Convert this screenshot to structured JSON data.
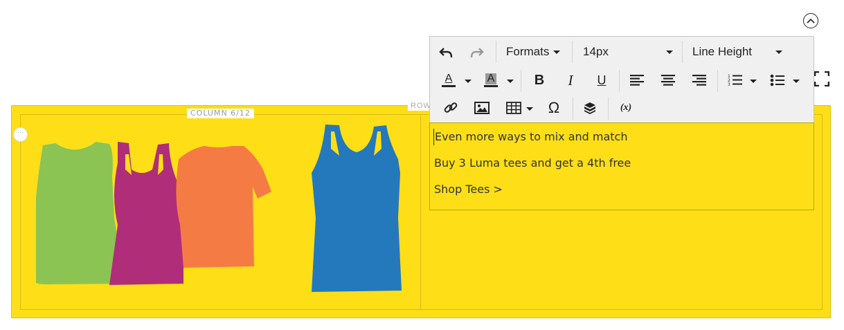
{
  "row": {
    "label": "ROW"
  },
  "column": {
    "label": "COLUMN 6/12",
    "options_label": "···"
  },
  "toolbar": {
    "formats_label": "Formats",
    "font_size_value": "14px",
    "line_height_label": "Line Height",
    "bold_label": "B",
    "italic_label": "I",
    "underline_label": "U",
    "font_color_label": "A",
    "highlight_label": "A",
    "variable_label": "(x)",
    "special_char_label": "Ω"
  },
  "editor": {
    "paragraphs": [
      "Even more ways to mix and match",
      "Buy 3 Luma tees and get a 4th free",
      "Shop Tees >"
    ]
  },
  "colors": {
    "row_background": "#fdde17",
    "shirt_green": "#8bc452",
    "shirt_magenta": "#b02d7a",
    "shirt_orange": "#f57b45",
    "shirt_blue": "#2479bd"
  },
  "icons": [
    "chevron-up-icon",
    "undo-icon",
    "redo-icon",
    "font-color-icon",
    "highlight-icon",
    "bold-icon",
    "italic-icon",
    "underline-icon",
    "align-left-icon",
    "align-center-icon",
    "align-right-icon",
    "numbered-list-icon",
    "bullet-list-icon",
    "fullscreen-icon",
    "link-icon",
    "image-icon",
    "table-icon",
    "special-character-icon",
    "widget-icon",
    "variable-icon"
  ]
}
